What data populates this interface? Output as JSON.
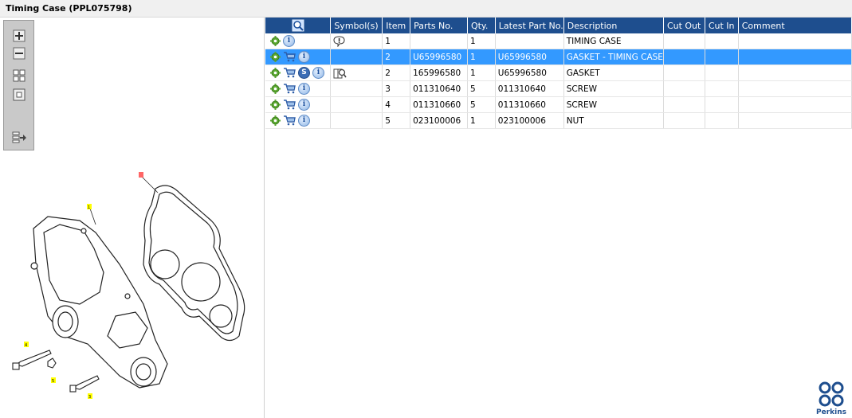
{
  "window": {
    "title": "Timing Case (PPL075798)"
  },
  "toolbar": {
    "buttons": [
      {
        "name": "zoom-in-icon"
      },
      {
        "name": "zoom-out-icon"
      },
      {
        "name": "fit-grid-icon"
      },
      {
        "name": "fit-window-icon"
      },
      {
        "name": "export-icon"
      }
    ]
  },
  "drawing": {
    "callouts": [
      "1",
      "4",
      "5",
      "3"
    ]
  },
  "table": {
    "headers": [
      "",
      "Symbol(s)",
      "Item",
      "Parts No.",
      "Qty.",
      "Latest Part No.",
      "Description",
      "Cut Out",
      "Cut In",
      "Comment"
    ],
    "rows": [
      {
        "icons": [
          "gear-icon",
          "info-icon"
        ],
        "symbol": "exclamation-bubble-icon",
        "item": "1",
        "part_no": "",
        "qty": "1",
        "latest": "",
        "description": "TIMING CASE",
        "cut_out": "",
        "cut_in": "",
        "comment": "",
        "selected": false
      },
      {
        "icons": [
          "gear-icon",
          "cart-icon",
          "info-icon"
        ],
        "symbol": "",
        "item": "2",
        "part_no": "U65996580",
        "qty": "1",
        "latest": "U65996580",
        "description": "GASKET - TIMING CASE",
        "cut_out": "",
        "cut_in": "",
        "comment": "",
        "selected": true
      },
      {
        "icons": [
          "gear-icon",
          "cart-icon",
          "s-icon",
          "info-icon"
        ],
        "symbol": "magnifier-book-icon",
        "item": "2",
        "part_no": "165996580",
        "qty": "1",
        "latest": "U65996580",
        "description": "GASKET",
        "cut_out": "",
        "cut_in": "",
        "comment": "",
        "selected": false
      },
      {
        "icons": [
          "gear-icon",
          "cart-icon",
          "info-icon"
        ],
        "symbol": "",
        "item": "3",
        "part_no": "011310640",
        "qty": "5",
        "latest": "011310640",
        "description": "SCREW",
        "cut_out": "",
        "cut_in": "",
        "comment": "",
        "selected": false
      },
      {
        "icons": [
          "gear-icon",
          "cart-icon",
          "info-icon"
        ],
        "symbol": "",
        "item": "4",
        "part_no": "011310660",
        "qty": "5",
        "latest": "011310660",
        "description": "SCREW",
        "cut_out": "",
        "cut_in": "",
        "comment": "",
        "selected": false
      },
      {
        "icons": [
          "gear-icon",
          "cart-icon",
          "info-icon"
        ],
        "symbol": "",
        "item": "5",
        "part_no": "023100006",
        "qty": "1",
        "latest": "023100006",
        "description": "NUT",
        "cut_out": "",
        "cut_in": "",
        "comment": "",
        "selected": false
      }
    ]
  },
  "brand": {
    "name": "Perkins",
    "color": "#1e4e8e"
  },
  "colors": {
    "header_bg": "#1e4e8e",
    "selected_row": "#3399ff",
    "gear": "#5aa830",
    "callout": "#ffff00",
    "callout_selected": "#ff6666"
  }
}
